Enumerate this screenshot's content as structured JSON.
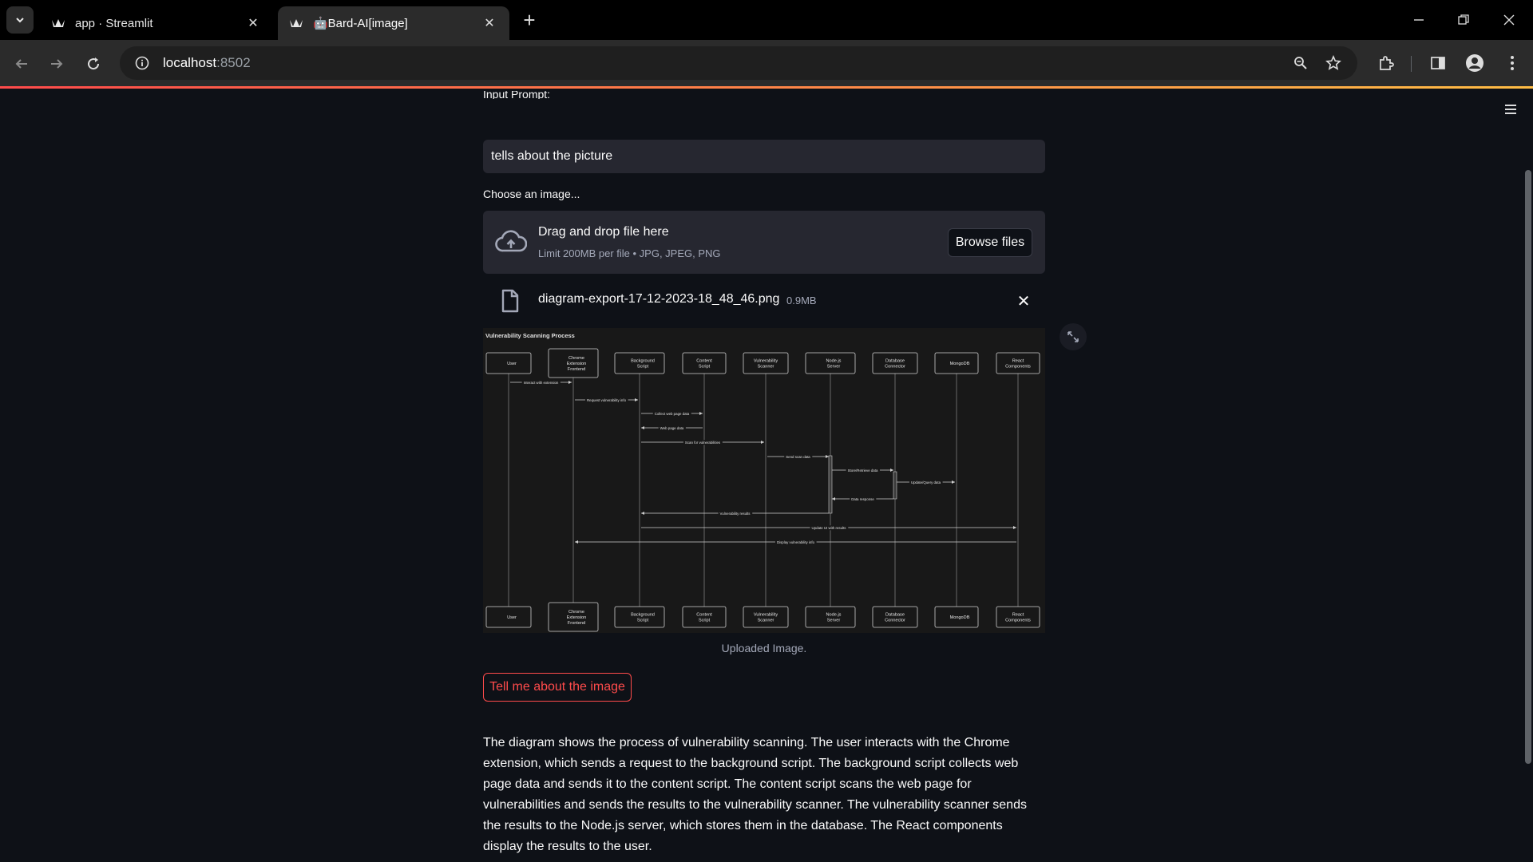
{
  "browser": {
    "tabs": [
      {
        "title": "app · Streamlit",
        "active": false,
        "favicon": "streamlit-crown-icon"
      },
      {
        "title": "🤖Bard-AI[image]",
        "active": true,
        "favicon": "streamlit-crown-icon"
      }
    ],
    "url_host": "localhost",
    "url_port": ":8502",
    "accent_gradient": [
      "#ff4b4b",
      "#ffbd45"
    ]
  },
  "app": {
    "prompt_label_partial": "Input Prompt:",
    "prompt_value": "tells about the picture",
    "uploader_label": "Choose an image...",
    "dropzone_title": "Drag and drop file here",
    "dropzone_subtitle": "Limit 200MB per file • JPG, JPEG, PNG",
    "browse_label": "Browse files",
    "file_name": "diagram-export-17-12-2023-18_48_46.png",
    "file_size": "0.9MB",
    "image_caption": "Uploaded Image.",
    "action_label": "Tell me about the image",
    "response": "The diagram shows the process of vulnerability scanning. The user interacts with the Chrome extension, which sends a request to the background script. The background script collects web page data and sends it to the content script. The content script scans the web page for vulnerabilities and sends the results to the vulnerability scanner. The vulnerability scanner sends the results to the Node.js server, which stores them in the database. The React components display the results to the user.",
    "colors": {
      "background": "#0e1117",
      "widget": "#262730",
      "primary": "#ff4b4b",
      "muted": "#a3a8b8"
    }
  },
  "diagram": {
    "title": "Vulnerability Scanning Process",
    "participants": [
      [
        "User"
      ],
      [
        "Chrome",
        "Extension",
        "Frontend"
      ],
      [
        "Background",
        "Script"
      ],
      [
        "Content",
        "Script"
      ],
      [
        "Vulnerability",
        "Scanner"
      ],
      [
        "Node.js",
        "Server"
      ],
      [
        "Database",
        "Connector"
      ],
      [
        "MongoDB"
      ],
      [
        "React",
        "Components"
      ]
    ],
    "messages": [
      {
        "from": 0,
        "to": 1,
        "label": "Interact with extension"
      },
      {
        "from": 1,
        "to": 2,
        "label": "Request vulnerability info"
      },
      {
        "from": 2,
        "to": 3,
        "label": "Collect web page data"
      },
      {
        "from": 3,
        "to": 2,
        "label": "Web page data"
      },
      {
        "from": 2,
        "to": 4,
        "label": "Scan for vulnerabilities"
      },
      {
        "from": 4,
        "to": 5,
        "label": "Send scan data"
      },
      {
        "from": 5,
        "to": 6,
        "label": "Store/Retrieve data"
      },
      {
        "from": 6,
        "to": 7,
        "label": "Update/Query data"
      },
      {
        "from": 6,
        "to": 5,
        "label": "Data response"
      },
      {
        "from": 5,
        "to": 2,
        "label": "Vulnerability results"
      },
      {
        "from": 2,
        "to": 8,
        "label": "Update UI with results"
      },
      {
        "from": 8,
        "to": 1,
        "label": "Display vulnerability info"
      }
    ]
  }
}
